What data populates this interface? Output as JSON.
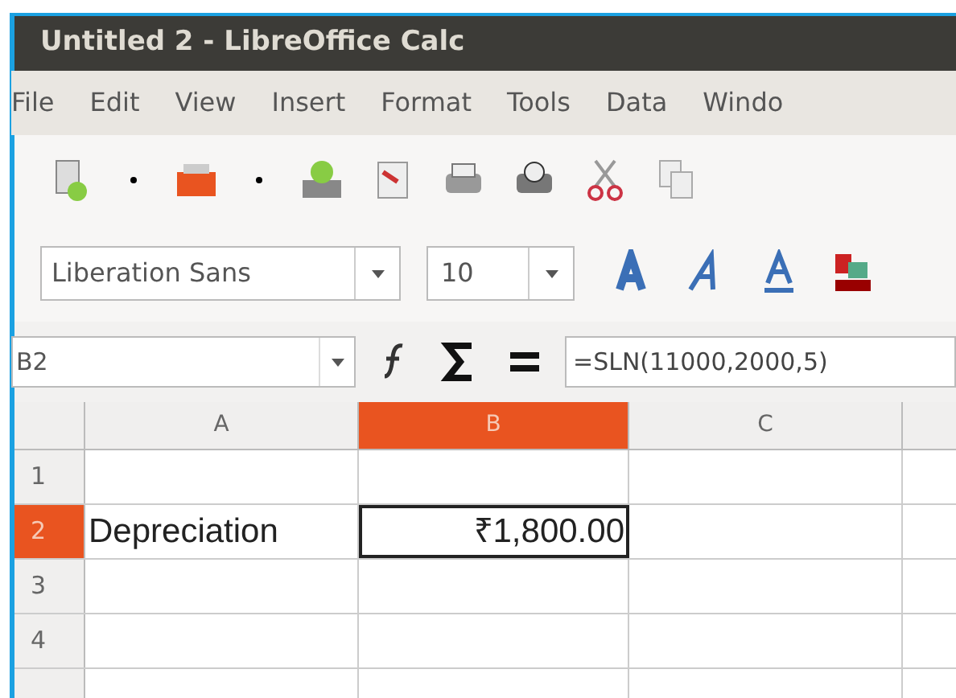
{
  "window": {
    "title": "Untitled 2 - LibreOffice Calc"
  },
  "menu": [
    "File",
    "Edit",
    "View",
    "Insert",
    "Format",
    "Tools",
    "Data",
    "Windo"
  ],
  "format_bar": {
    "font_name": "Liberation Sans",
    "font_size": "10"
  },
  "formula_bar": {
    "name_box": "B2",
    "formula": "=SLN(11000,2000,5)"
  },
  "sheet": {
    "columns": [
      {
        "label": "A",
        "selected": false
      },
      {
        "label": "B",
        "selected": true
      },
      {
        "label": "C",
        "selected": false
      }
    ],
    "rows": [
      {
        "label": "1",
        "selected": false,
        "cells": []
      },
      {
        "label": "2",
        "selected": true,
        "cells": [
          {
            "text": "Depreciation",
            "kind": "text"
          },
          {
            "text": "₹1,800.00",
            "kind": "number",
            "active": true
          }
        ]
      },
      {
        "label": "3",
        "selected": false,
        "cells": []
      },
      {
        "label": "4",
        "selected": false,
        "cells": []
      }
    ]
  }
}
